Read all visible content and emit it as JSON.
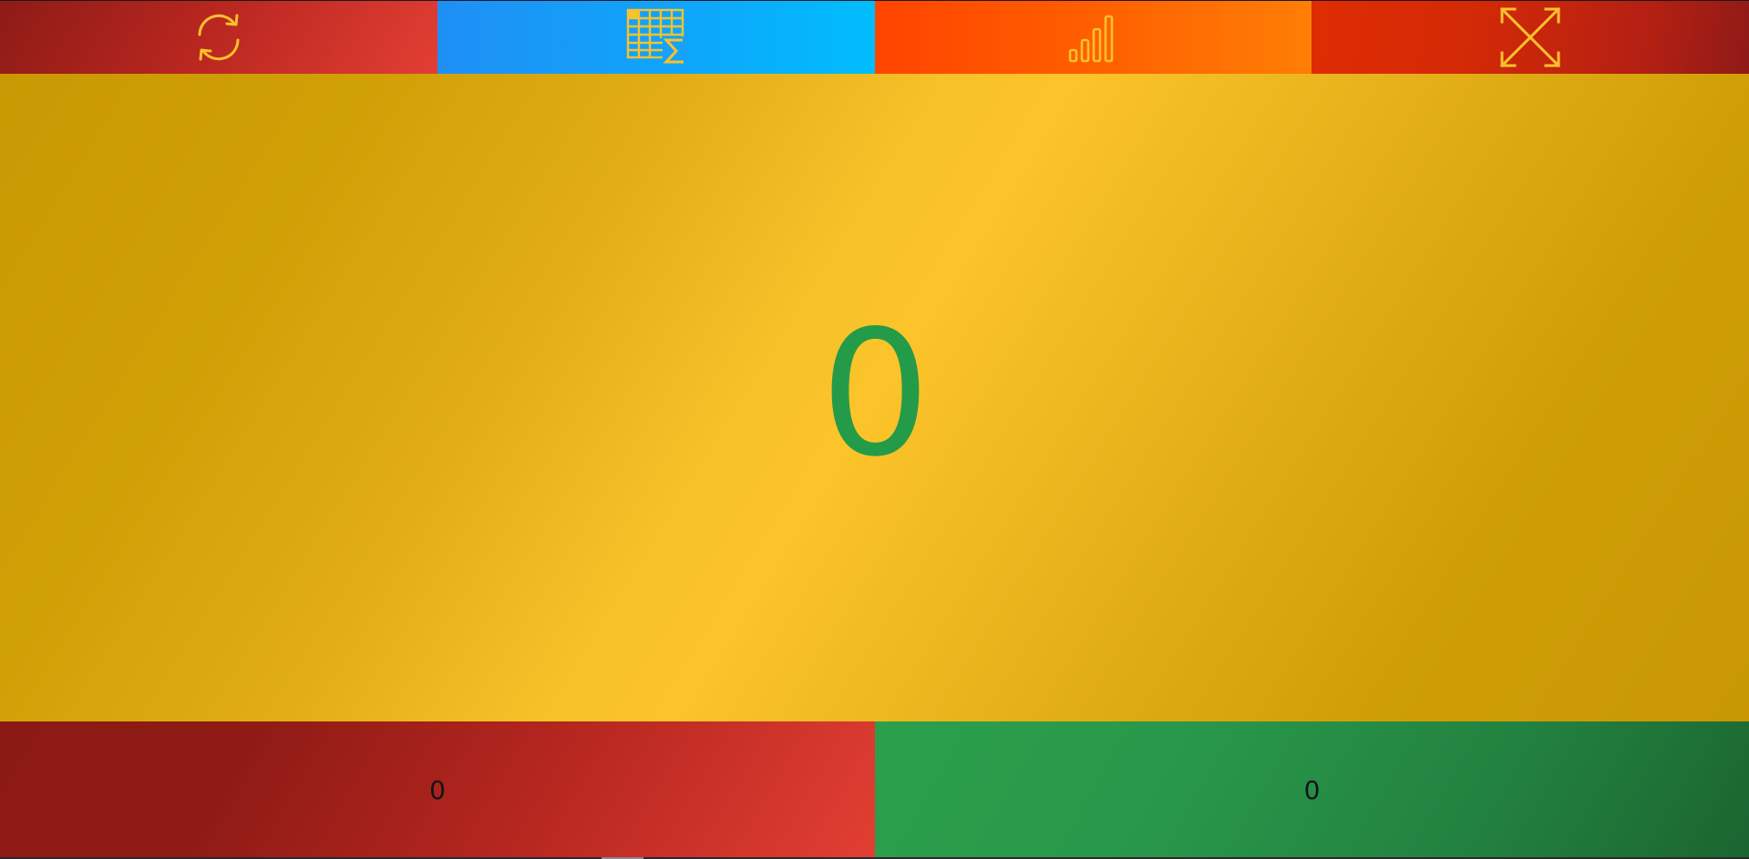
{
  "toolbar": {
    "buttons": [
      {
        "id": "reset",
        "icon": "refresh-icon",
        "icon_color": "#f9c12c"
      },
      {
        "id": "table",
        "icon": "table-sum-icon",
        "icon_color": "#f9c12c"
      },
      {
        "id": "stats",
        "icon": "bar-chart-icon",
        "icon_color": "#f9c12c"
      },
      {
        "id": "fullscreen",
        "icon": "expand-icon",
        "icon_color": "#f9c12c"
      }
    ]
  },
  "main": {
    "count": "0",
    "count_color": "#249b48"
  },
  "bottom": {
    "left_count": "0",
    "right_count": "0"
  },
  "colors": {
    "red": "#c72d24",
    "blue": "#0fa5fb",
    "orange": "#ff5c00",
    "gold": "#f6c129",
    "green": "#28974a"
  }
}
